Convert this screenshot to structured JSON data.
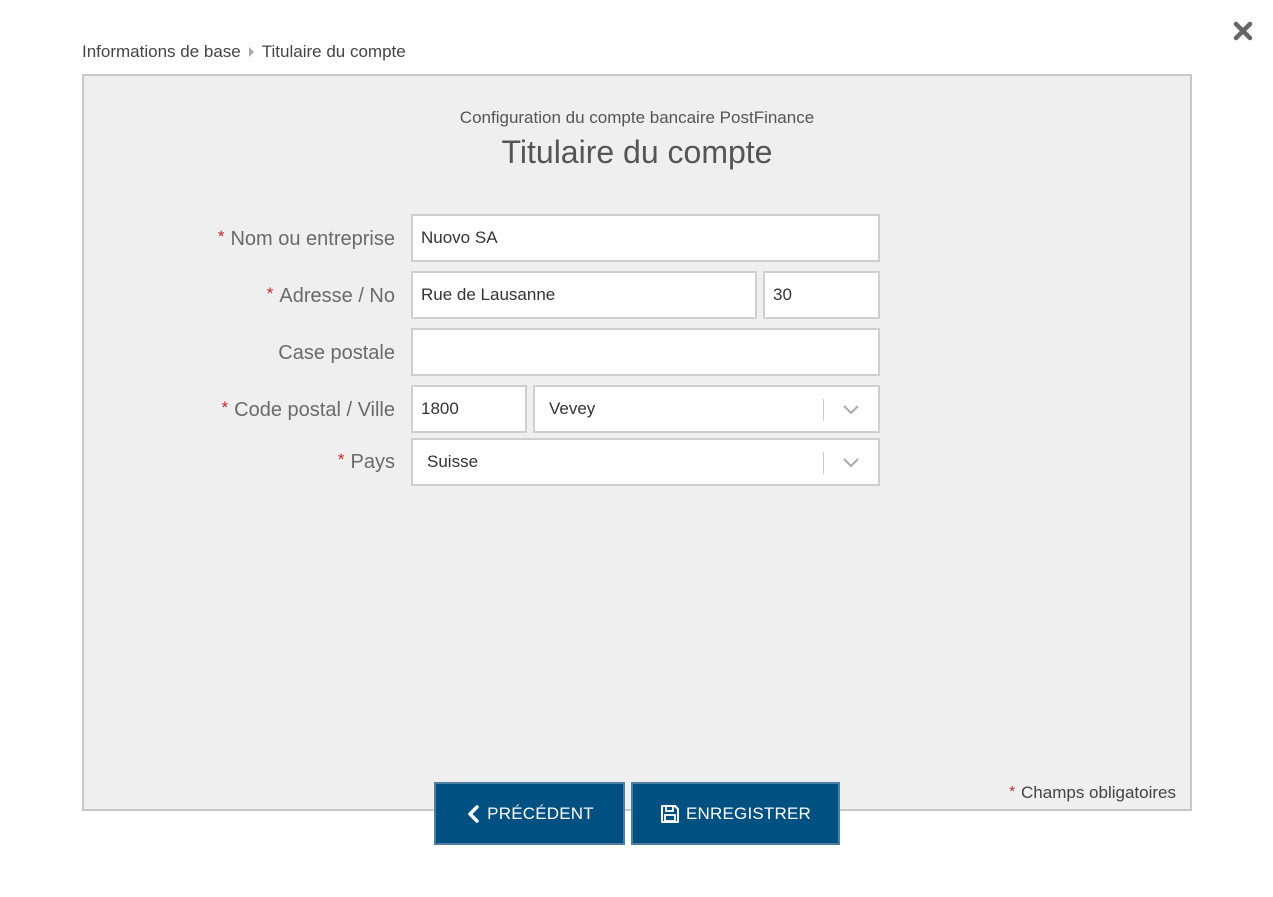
{
  "breadcrumb": {
    "items": [
      "Informations de base",
      "Titulaire du compte"
    ]
  },
  "close": {
    "icon": "close-icon"
  },
  "header": {
    "subtitle": "Configuration du compte bancaire PostFinance",
    "title": "Titulaire du compte"
  },
  "form": {
    "name": {
      "label": "Nom ou entreprise",
      "required": true,
      "value": "Nuovo SA"
    },
    "address": {
      "label": "Adresse / No",
      "required": true,
      "street": "Rue de Lausanne",
      "number": "30"
    },
    "pobox": {
      "label": "Case postale",
      "required": false,
      "value": ""
    },
    "postal": {
      "label": "Code postal / Ville",
      "required": true,
      "code": "1800",
      "city": "Vevey"
    },
    "country": {
      "label": "Pays",
      "required": true,
      "value": "Suisse"
    }
  },
  "required_marker": "*",
  "footer_note": "Champs obligatoires",
  "buttons": {
    "previous": "PRÉCÉDENT",
    "save": "ENREGISTRER"
  },
  "colors": {
    "primary": "#005082",
    "required": "#c62828",
    "panel_bg": "#efefef"
  }
}
